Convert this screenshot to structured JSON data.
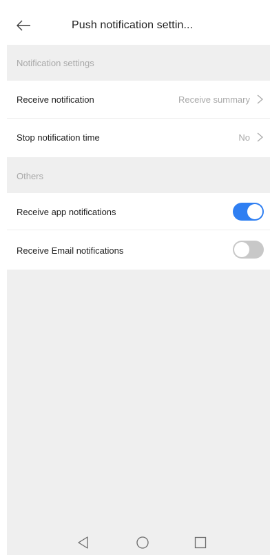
{
  "header": {
    "title": "Push notification settin..."
  },
  "sections": [
    {
      "title": "Notification settings",
      "rows": [
        {
          "label": "Receive notification",
          "value": "Receive summary"
        },
        {
          "label": "Stop notification time",
          "value": "No"
        }
      ]
    },
    {
      "title": "Others",
      "rows": [
        {
          "label": "Receive app notifications",
          "toggle_on": true
        },
        {
          "label": "Receive Email notifications",
          "toggle_on": false
        }
      ]
    }
  ],
  "colors": {
    "toggle_on": "#2f7ff2",
    "toggle_off": "#c8c8c8",
    "background": "#efefef"
  },
  "icons": {
    "back": "arrow-left-icon",
    "chevron": "chevron-right-icon",
    "nav_back": "triangle-back-icon",
    "nav_home": "circle-home-icon",
    "nav_recents": "square-recents-icon"
  }
}
